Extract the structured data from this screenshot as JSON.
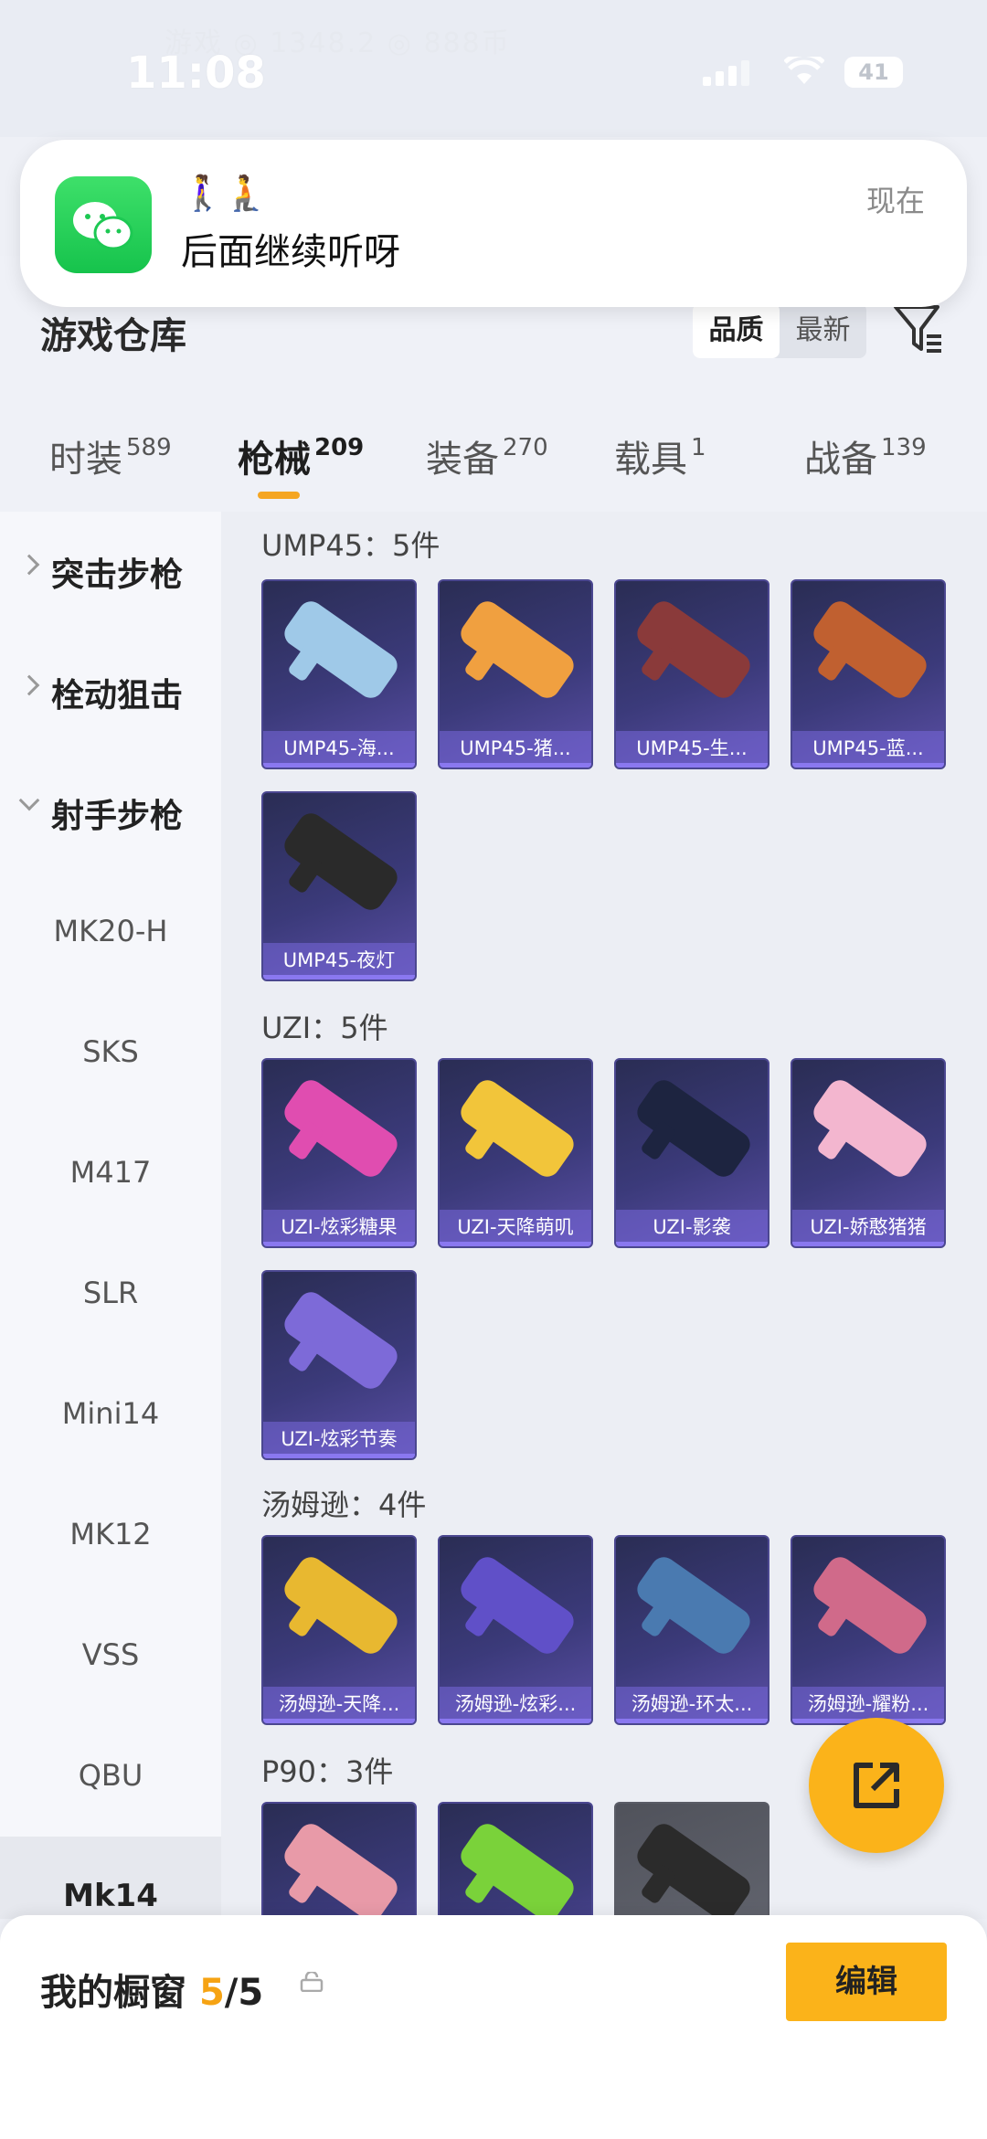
{
  "status_bar": {
    "time": "11:08",
    "battery": "41",
    "faded_background_text": "游戏 ◎ 1348.2 ◎ 888币"
  },
  "notification": {
    "app_icon": "wechat-icon",
    "emoji": "🚶‍♀️🧎",
    "message": "后面继续听呀",
    "time": "现在"
  },
  "header": {
    "title": "游戏仓库",
    "sort_options": [
      "品质",
      "最新"
    ],
    "active_sort": "品质",
    "filter_icon": "filter-icon"
  },
  "tabs": [
    {
      "label": "时装",
      "count": "589"
    },
    {
      "label": "枪械",
      "count": "209"
    },
    {
      "label": "装备",
      "count": "270"
    },
    {
      "label": "载具",
      "count": "1"
    },
    {
      "label": "战备",
      "count": "139"
    }
  ],
  "active_tab": "枪械",
  "sidebar": {
    "categories": [
      "突击步枪",
      "栓动狙击",
      "射手步枪"
    ],
    "items": [
      "MK20-H",
      "SKS",
      "M417",
      "SLR",
      "Mini14",
      "MK12",
      "VSS",
      "QBU"
    ],
    "active": "Mk14"
  },
  "groups": [
    {
      "title": "UMP45：5件",
      "items": [
        "UMP45-海...",
        "UMP45-猪...",
        "UMP45-生...",
        "UMP45-蓝...",
        "UMP45-夜灯"
      ]
    },
    {
      "title": "UZI：5件",
      "items": [
        "UZI-炫彩糖果",
        "UZI-天降萌叽",
        "UZI-影袭",
        "UZI-娇憨猪猪",
        "UZI-炫彩节奏"
      ]
    },
    {
      "title": "汤姆逊：4件",
      "items": [
        "汤姆逊-天降...",
        "汤姆逊-炫彩...",
        "汤姆逊-环太...",
        "汤姆逊-耀粉..."
      ]
    },
    {
      "title": "P90：3件",
      "items": [
        "",
        "",
        ""
      ]
    }
  ],
  "bottom": {
    "title": "我的橱窗",
    "count_current": "5",
    "count_total": "/5",
    "edit_label": "编辑"
  },
  "colors": {
    "accent": "#fbb31a",
    "card_bg": "#3b3a7a",
    "count_highlight": "#f6a313"
  }
}
